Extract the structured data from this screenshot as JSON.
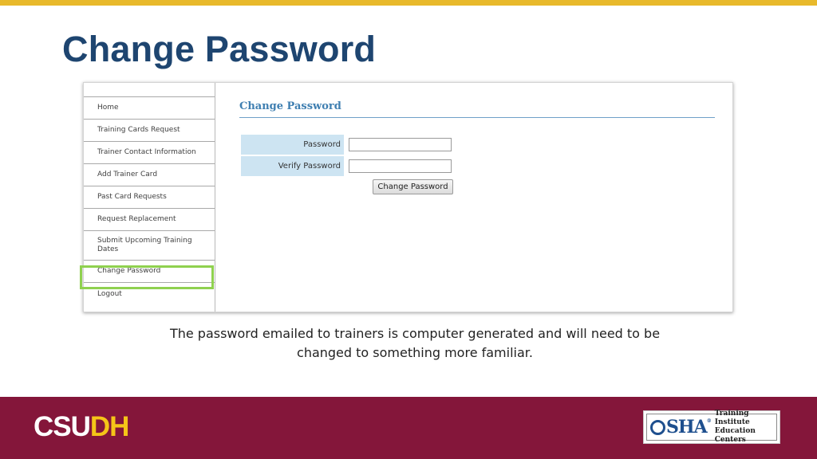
{
  "slide": {
    "title": "Change Password",
    "caption": "The password emailed to trainers is computer generated and will need to be changed to something more familiar."
  },
  "sidebar": {
    "items": [
      {
        "label": "Home"
      },
      {
        "label": "Training Cards Request"
      },
      {
        "label": "Trainer Contact Information"
      },
      {
        "label": "Add Trainer Card"
      },
      {
        "label": "Past Card Requests"
      },
      {
        "label": "Request Replacement"
      },
      {
        "label": "Submit Upcoming Training Dates"
      },
      {
        "label": "Change Password",
        "highlighted": true
      },
      {
        "label": "Logout"
      }
    ]
  },
  "form": {
    "heading": "Change Password",
    "password_label": "Password",
    "password_value": "",
    "verify_label": "Verify Password",
    "verify_value": "",
    "submit_label": "Change Password"
  },
  "footer": {
    "logo_part1": "CSU",
    "logo_part2": "DH",
    "osha_mark": "SHA",
    "osha_registered": "®",
    "osha_line1": "Training Institute",
    "osha_line2": "Education Centers"
  },
  "colors": {
    "top_bar": "#e8b92b",
    "title": "#1e4570",
    "footer_bg": "#84163a",
    "logo_white": "#ffffff",
    "logo_gold": "#f5c518",
    "highlight": "#8fd14f",
    "form_label_bg": "#cde4f2",
    "form_heading": "#3f7fb1"
  },
  "icons": {
    "osha_o": "osha-o-ring-icon"
  }
}
